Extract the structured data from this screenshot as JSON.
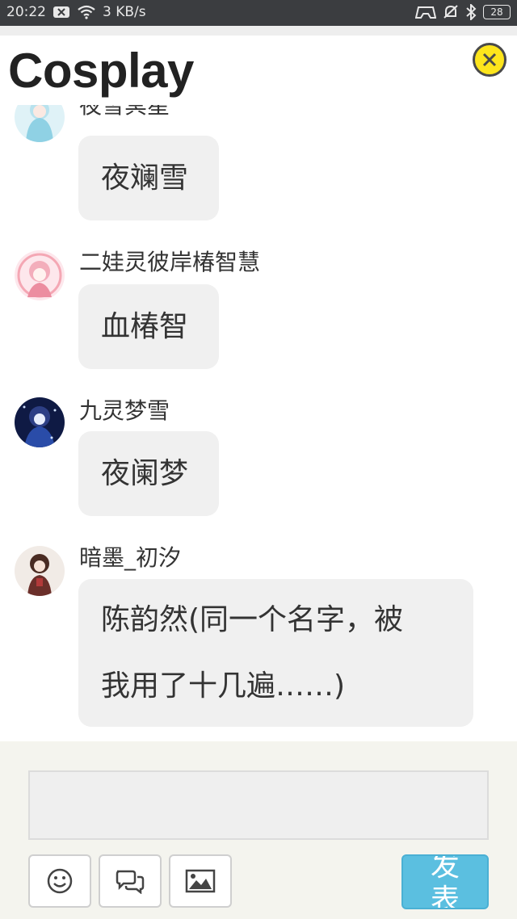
{
  "status_bar": {
    "time": "20:22",
    "net_speed": "3 KB/s",
    "battery": "28"
  },
  "header": {
    "title": "Cosplay"
  },
  "messages": [
    {
      "sender": "夜雪冥星",
      "text": "夜斓雪",
      "avatar": "avatar-light-blue-anime"
    },
    {
      "sender": "二娃灵彼岸椿智慧",
      "text": "血椿智",
      "avatar": "avatar-pink-anime"
    },
    {
      "sender": "九灵梦雪",
      "text": "夜阑梦",
      "avatar": "avatar-dark-blue-anime"
    },
    {
      "sender": "暗墨_初汐",
      "text_lines": [
        "陈韵然(同一个名字，被",
        "我用了十几遍……)"
      ],
      "avatar": "avatar-brown-anime"
    }
  ],
  "composer": {
    "input_value": "",
    "send_label": "发表",
    "tools": [
      "emoji-icon",
      "chat-bubbles-icon",
      "image-icon"
    ]
  },
  "colors": {
    "status_bar_bg": "#3b3d40",
    "close_button": "#fde51c",
    "bubble_bg": "#f0f0f0",
    "composer_bg": "#f4f4ee",
    "send_button": "#5bbfe0"
  }
}
